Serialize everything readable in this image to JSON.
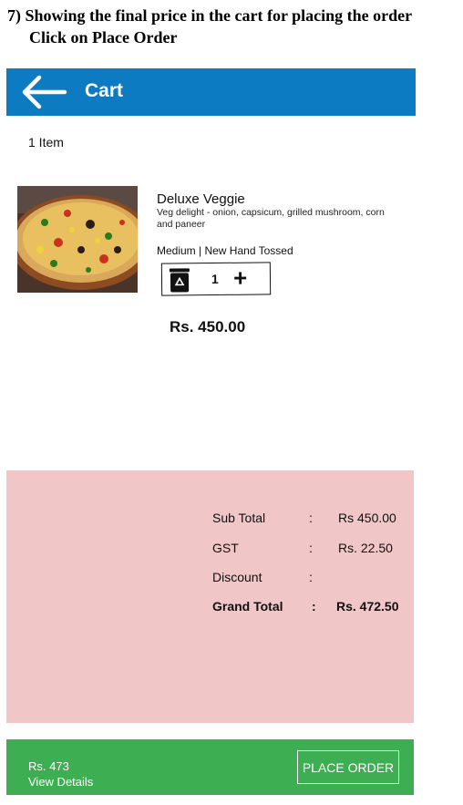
{
  "caption": {
    "line1": "7) Showing the final price in the cart for placing the order",
    "line2": "Click on Place Order"
  },
  "appbar": {
    "title": "Cart",
    "color": "#0d7bc1",
    "back_icon": "arrow-left-icon"
  },
  "cart": {
    "item_count": "1 Item",
    "item": {
      "name": "Deluxe Veggie",
      "description": "Veg delight - onion, capsicum, grilled mushroom, corn and paneer",
      "variant": "Medium | New Hand Tossed",
      "quantity": "1",
      "price": "Rs. 450.00",
      "delete_icon": "recycle-bin-icon",
      "add_icon": "plus-icon",
      "image": "pizza-photo"
    }
  },
  "summary": {
    "background": "#f0c6c6",
    "rows": [
      {
        "label": "Sub Total",
        "colon": ":",
        "value": "Rs 450.00"
      },
      {
        "label": "GST",
        "colon": ":",
        "value": "Rs. 22.50"
      },
      {
        "label": "Discount",
        "colon": ":",
        "value": ""
      },
      {
        "label": "Grand Total",
        "colon": ":",
        "value": "Rs. 472.50"
      }
    ]
  },
  "footer": {
    "amount": "Rs. 473",
    "details_link": "View Details",
    "place_order_label": "PLACE ORDER",
    "color": "#3eae53"
  }
}
